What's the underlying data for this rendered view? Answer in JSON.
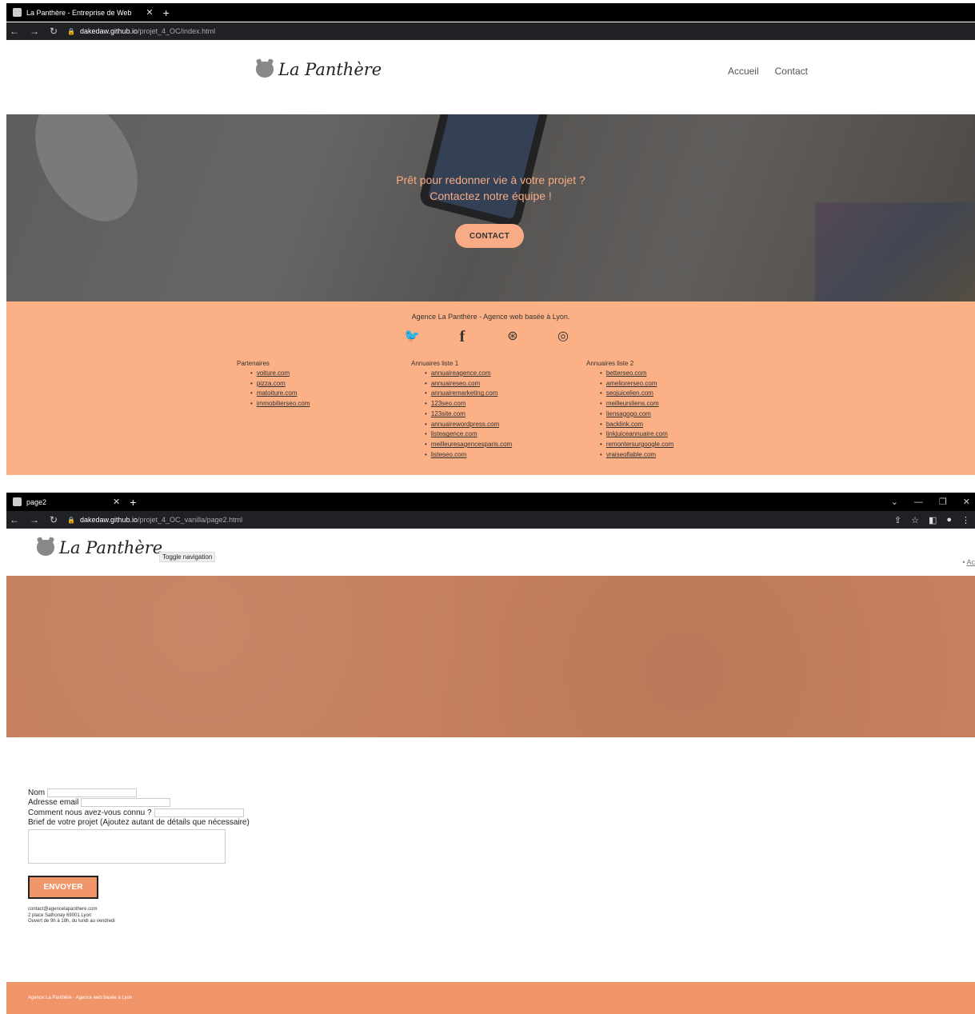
{
  "window1": {
    "tab_title": "La Panthère - Entreprise de Web",
    "url_host": "dakedaw.github.io",
    "url_path": "/projet_4_OC/index.html"
  },
  "page1": {
    "logo_text": "La Panthère",
    "nav": [
      "Accueil",
      "Contact"
    ],
    "hero_line1": "Prêt pour redonner vie à votre projet ?",
    "hero_line2": "Contactez notre équipe !",
    "hero_button": "CONTACT",
    "footer_title": "Agence La Panthère - Agence web basée à Lyon.",
    "social_icons": [
      "twitter-icon",
      "facebook-icon",
      "dribbble-icon",
      "instagram-icon"
    ],
    "columns": [
      {
        "title": "Partenaires",
        "links": [
          "voiture.com",
          "pizza.com",
          "matoiture.com",
          "immobilierseo.com"
        ]
      },
      {
        "title": "Annuaires liste 1",
        "links": [
          "annuaireagence.com",
          "annuaireseo.com",
          "annuairemarketing.com",
          "123seo.com",
          "123site.com",
          "annuairewordpress.com",
          "listeagence.com",
          "meilleuresagencesparis.com",
          "listeseo.com"
        ]
      },
      {
        "title": "Annuaires liste 2",
        "links": [
          "betterseo.com",
          "ameliorerseo.com",
          "seojuicelien.com",
          "meilleursliens.com",
          "liensagogo.com",
          "backlink.com",
          "linkjuiceannuaire.com",
          "remontersurgoogle.com",
          "vraiseofiable.com"
        ]
      }
    ]
  },
  "window2": {
    "tab_title": "page2",
    "url_host": "dakedaw.github.io",
    "url_path": "/projet_4_OC_vanilla/page2.html"
  },
  "page2": {
    "logo_text": "La Panthère",
    "toggle_label": "Toggle navigation",
    "nav_partial": "Ac",
    "form": {
      "name_label": "Nom",
      "email_label": "Adresse email",
      "source_label": "Comment nous avez-vous connu ?",
      "brief_label": "Brief de votre projet (Ajoutez autant de détails que nécessaire)",
      "submit_label": "ENVOYER"
    },
    "contact": {
      "email": "contact@agencelapanthere.com",
      "address": "2 place Sathonay 69001 Lyon",
      "hours": "Ouvert de 9h à 18h, du lundi au vendredi"
    },
    "footer_text": "Agence La Panthère - Agence web basée à Lyon"
  },
  "colors": {
    "peach": "#fcb085",
    "salmon": "#f0946a",
    "banner": "#c5805e"
  }
}
